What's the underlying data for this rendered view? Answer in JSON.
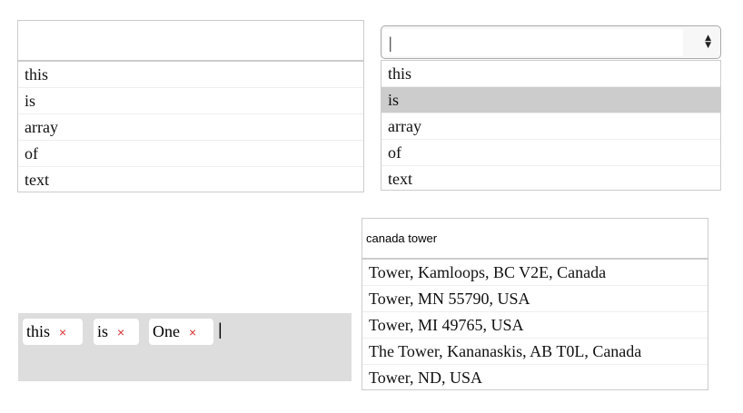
{
  "autocomplete1": {
    "value": "",
    "items": [
      "this",
      "is",
      "array",
      "of",
      "text"
    ]
  },
  "autocomplete2": {
    "value": "|",
    "items": [
      "this",
      "is",
      "array",
      "of",
      "text"
    ],
    "highlighted": 1
  },
  "tags": {
    "items": [
      "this",
      "is",
      "One"
    ],
    "remove_glyph": "×",
    "cursor": "|"
  },
  "places": {
    "value": "canada tower",
    "items": [
      "Tower, Kamloops, BC V2E, Canada",
      "Tower, MN 55790, USA",
      "Tower, MI 49765, USA",
      "The Tower, Kananaskis, AB T0L, Canada",
      "Tower, ND, USA"
    ]
  }
}
